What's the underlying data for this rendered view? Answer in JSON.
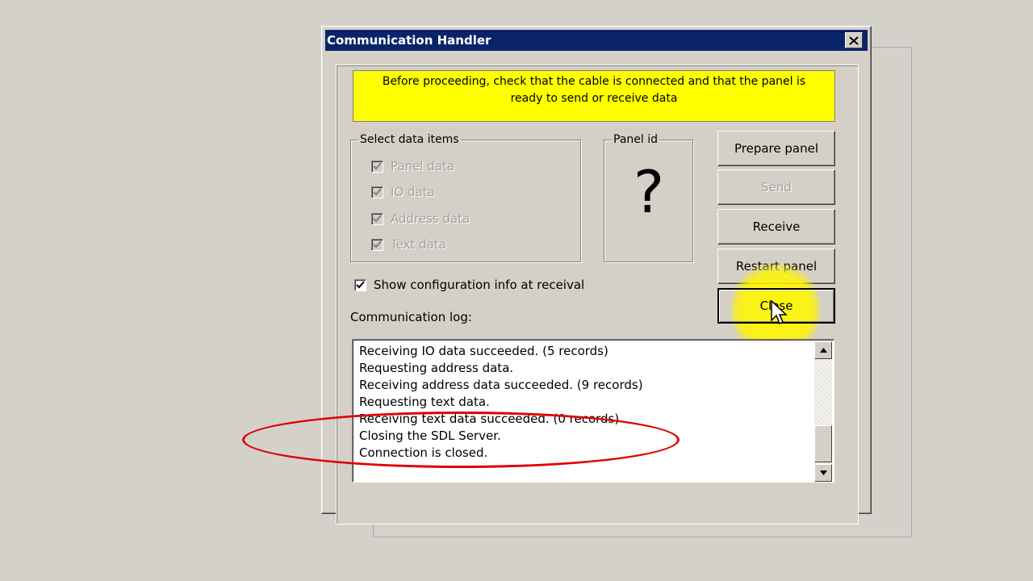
{
  "window": {
    "title": "Communication Handler"
  },
  "banner": {
    "text_line1": "Before proceeding, check that  the cable is connected and that the panel is",
    "text_line2": "ready to send or receive data"
  },
  "select_group": {
    "label": "Select data items",
    "items": [
      {
        "label": "Panel data",
        "checked": true,
        "enabled": false
      },
      {
        "label": "IO data",
        "checked": true,
        "enabled": false
      },
      {
        "label": "Address data",
        "checked": true,
        "enabled": false
      },
      {
        "label": "Text data",
        "checked": true,
        "enabled": false
      }
    ]
  },
  "panel_id": {
    "label": "Panel id",
    "value": "?"
  },
  "buttons": {
    "prepare": "Prepare panel",
    "send": "Send",
    "receive": "Receive",
    "restart": "Restart panel",
    "close": "Close"
  },
  "show_config": {
    "label": "Show configuration info at receival",
    "checked": true
  },
  "log": {
    "label": "Communication log:",
    "lines": [
      "Receiving IO data succeeded. (5 records)",
      "Requesting address data.",
      "Receiving address data succeeded. (9 records)",
      "Requesting text data.",
      "Receiving text data succeeded. (0 records)",
      "Closing the SDL Server.",
      "Connection is closed."
    ]
  },
  "colors": {
    "title_bar": "#0a246a",
    "banner": "#ffff00",
    "annotation": "#e00000",
    "cursor_highlight": "#fff500"
  }
}
